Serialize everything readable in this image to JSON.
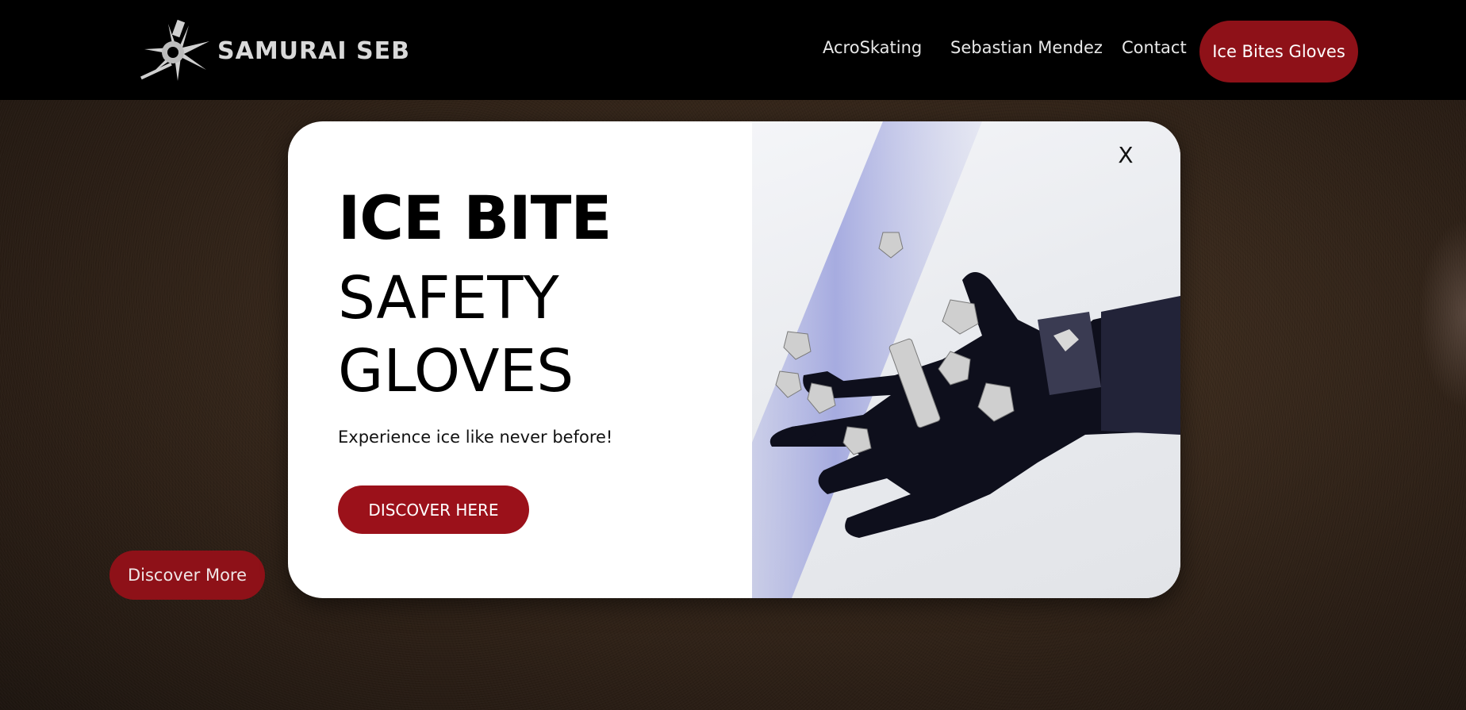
{
  "header": {
    "logo_text": "SAMURAI SEB",
    "nav": [
      {
        "label": "AcroSkating"
      },
      {
        "label": "Sebastian Mendez"
      },
      {
        "label": "Contact"
      }
    ],
    "cta_label": "Ice Bites Gloves"
  },
  "hero": {
    "discover_more_label": "Discover More"
  },
  "modal": {
    "title_bold": "ICE BITE",
    "title_line2": "SAFETY",
    "title_line3": "GLOVES",
    "subtitle": "Experience ice like never before!",
    "button_label": "DISCOVER HERE",
    "close_label": "X",
    "image_icon": "glove-photo"
  },
  "colors": {
    "accent": "#8e1118",
    "header_bg": "#000000",
    "modal_bg": "#ffffff"
  }
}
